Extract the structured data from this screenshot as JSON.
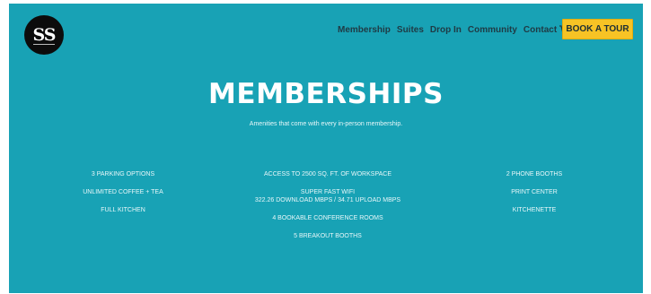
{
  "brand": {
    "logo_text": "SS"
  },
  "nav": {
    "links": [
      "Membership",
      "Suites",
      "Drop In",
      "Community",
      "Contact"
    ],
    "cart_icon": "cart-icon",
    "cta_label": "BOOK A TOUR"
  },
  "hero": {
    "title": "MEMBERSHIPS",
    "subtitle": "Amenities that come with every in-person membership."
  },
  "amenities": {
    "left": [
      "3 PARKING OPTIONS",
      "UNLIMITED COFFEE + TEA",
      "FULL KITCHEN"
    ],
    "middle": {
      "workspace": "ACCESS TO 2500 SQ. FT. OF WORKSPACE",
      "wifi": "SUPER FAST WIFI",
      "wifi_speed": "322.26 DOWNLOAD MBPS / 34.71 UPLOAD MBPS",
      "conference": "4 BOOKABLE CONFERENCE ROOMS",
      "breakout": "5 BREAKOUT BOOTHS"
    },
    "right": [
      "2 PHONE BOOTHS",
      "PRINT CENTER",
      "KITCHENETTE"
    ]
  },
  "colors": {
    "background": "#18a2b5",
    "cta": "#f7c325",
    "nav_text": "#1f3a44",
    "logo": "#0c0c0c"
  }
}
